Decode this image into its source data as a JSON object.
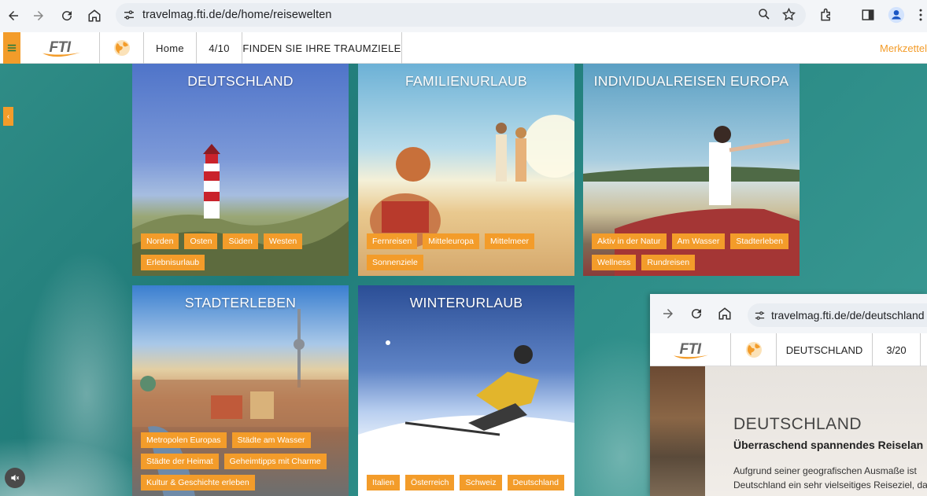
{
  "browser": {
    "url": "travelmag.fti.de/de/home/reisewelten"
  },
  "site_header": {
    "logo": "FTI",
    "home_label": "Home",
    "page_counter": "4/10",
    "section_title": "FINDEN SIE IHRE TRAUMZIELE",
    "merkzettel_label": "Merkzettel"
  },
  "tiles": [
    {
      "title": "DEUTSCHLAND",
      "tags": [
        "Norden",
        "Osten",
        "Süden",
        "Westen",
        "Erlebnisurlaub"
      ]
    },
    {
      "title": "FAMILIENURLAUB",
      "tags": [
        "Fernreisen",
        "Mitteleuropa",
        "Mittelmeer",
        "Sonnenziele"
      ]
    },
    {
      "title": "INDIVIDUALREISEN EUROPA",
      "tags": [
        "Aktiv in der Natur",
        "Am Wasser",
        "Stadterleben",
        "Wellness",
        "Rundreisen"
      ]
    },
    {
      "title": "STADTERLEBEN",
      "tags": [
        "Metropolen Europas",
        "Städte am Wasser",
        "Städte der Heimat",
        "Geheimtipps mit Charme",
        "Kultur & Geschichte erleben"
      ]
    },
    {
      "title": "WINTERURLAUB",
      "tags": [
        "Italien",
        "Österreich",
        "Schweiz",
        "Deutschland"
      ]
    }
  ],
  "second_window": {
    "url": "travelmag.fti.de/de/deutschland",
    "logo": "FTI",
    "section_title": "DEUTSCHLAND",
    "page_counter": "3/20",
    "heading": "DEUTSCHLAND",
    "subheading": "Überraschend spannendes Reiselan",
    "body_line1": "Aufgrund seiner geografischen Ausmaße ist",
    "body_line2": "Deutschland ein sehr vielseitiges Reiseziel, da"
  },
  "colors": {
    "accent": "#f39c2a",
    "ocean": "#1f7a78"
  },
  "icons": {
    "back": "back-arrow-icon",
    "forward": "forward-arrow-icon",
    "reload": "reload-icon",
    "home": "home-icon",
    "site_info": "tune-icon",
    "zoom": "zoom-icon",
    "bookmark": "star-icon",
    "extensions": "puzzle-icon",
    "sidepanel": "side-panel-icon",
    "profile": "profile-icon",
    "menu": "kebab-menu-icon",
    "globe": "globe-icon",
    "mute": "speaker-icon"
  }
}
